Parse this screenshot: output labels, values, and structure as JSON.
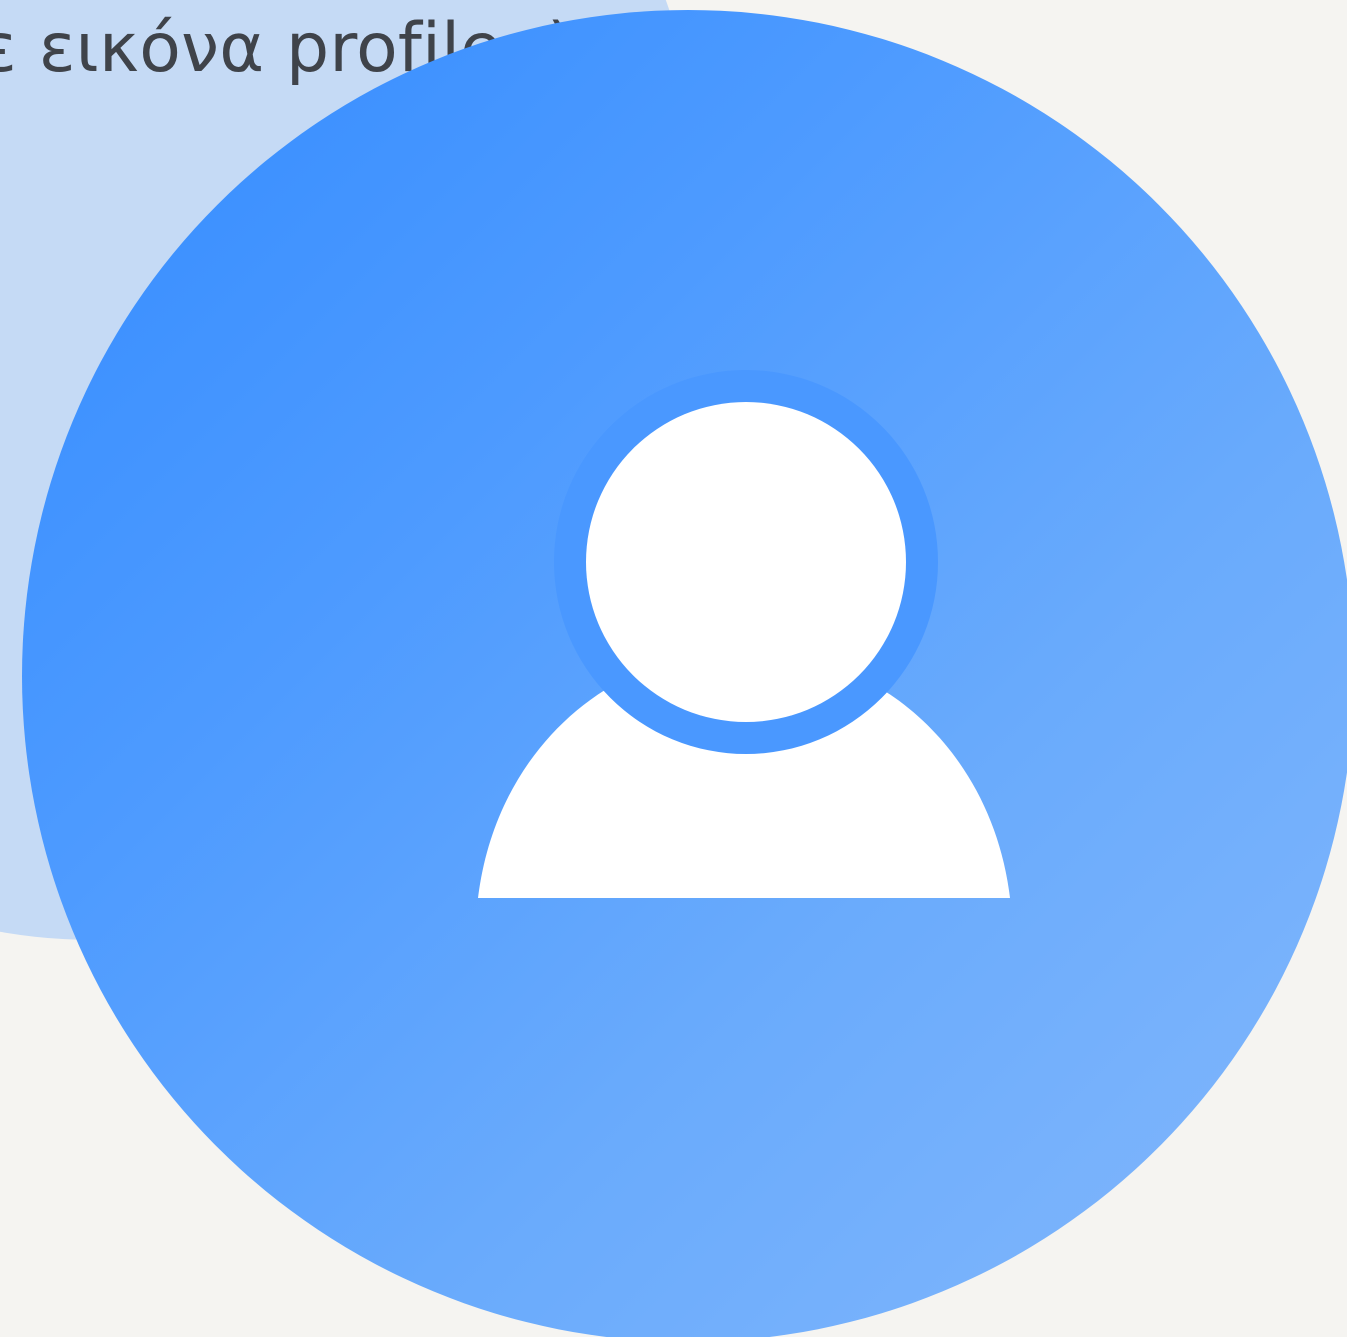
{
  "profile": {
    "hint_text": "ε εικόνα profile ;)",
    "avatar_icon": "user-silhouette-icon"
  },
  "colors": {
    "page_background": "#f5f4f1",
    "background_blob": "#c5daf5",
    "avatar_gradient_start": "#338bff",
    "avatar_gradient_end": "#84b8fb",
    "silhouette": "#ffffff",
    "head_ring": "#4a98ff",
    "text": "#3f434a"
  }
}
